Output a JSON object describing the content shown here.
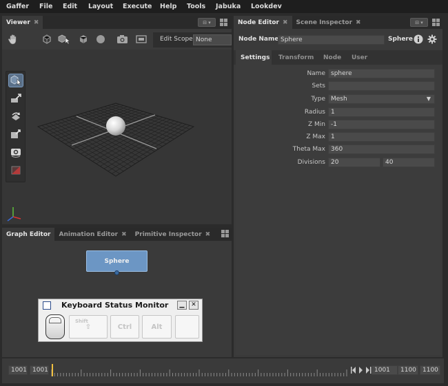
{
  "menu": [
    "Gaffer",
    "File",
    "Edit",
    "Layout",
    "Execute",
    "Help",
    "Tools",
    "Jabuka",
    "Lookdev"
  ],
  "viewer": {
    "tab_label": "Viewer",
    "edit_scope_label": "Edit Scope",
    "edit_scope_value": "None"
  },
  "node_editor": {
    "tabs": [
      "Node Editor",
      "Scene Inspector"
    ],
    "node_name_label": "Node Name",
    "node_name_value": "Sphere",
    "node_type": "Sphere",
    "subtabs": [
      "Settings",
      "Transform",
      "Node",
      "User"
    ],
    "fields": [
      {
        "label": "Name",
        "value": "sphere"
      },
      {
        "label": "Sets",
        "value": ""
      },
      {
        "label": "Type",
        "value": "Mesh"
      },
      {
        "label": "Radius",
        "value": "1"
      },
      {
        "label": "Z Min",
        "value": "-1"
      },
      {
        "label": "Z Max",
        "value": "1"
      },
      {
        "label": "Theta Max",
        "value": "360"
      }
    ],
    "divisions_label": "Divisions",
    "divisions": [
      "20",
      "40"
    ]
  },
  "graph": {
    "tabs": [
      "Graph Editor",
      "Animation Editor",
      "Primitive Inspector"
    ],
    "node_label": "Sphere"
  },
  "keyboard_monitor": {
    "title": "Keyboard Status Monitor",
    "keys": [
      "Shift",
      "Ctrl",
      "Alt",
      ""
    ]
  },
  "timeline": {
    "start": "1001",
    "current": "1001",
    "play_start": "1001",
    "play_end": "1100",
    "end": "1100"
  }
}
